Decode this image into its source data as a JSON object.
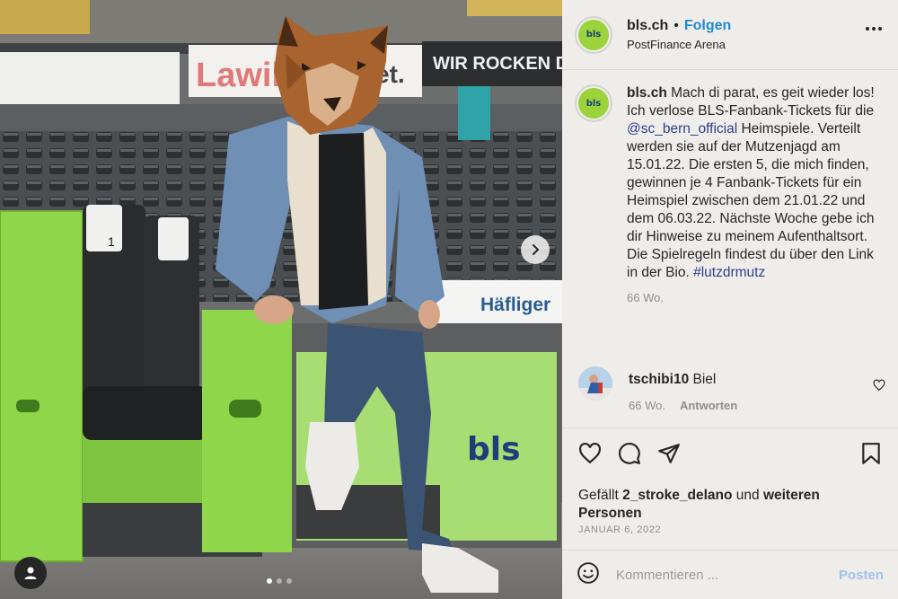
{
  "post": {
    "username": "bls.ch",
    "separator": "•",
    "follow_label": "Folgen",
    "location": "PostFinance Arena",
    "brand_logo_text": "bls"
  },
  "photo": {
    "stadium_banner_left": "Lawil",
    "stadium_banner_mid": "et.",
    "stadium_banner_right": "WIR ROCKEN D",
    "sponsor_board": "Häfliger",
    "bench_logo": "bls",
    "seat_number": "1",
    "carousel_total": 3,
    "carousel_current": 1
  },
  "caption": {
    "username": "bls.ch",
    "part1": " Mach di parat, es geit wieder los! Ich verlose BLS-Fanbank-Tickets für die ",
    "mention": "@sc_bern_official",
    "part2": " Heimspiele. Verteilt werden sie auf der Mutzenjagd am 15.01.22. Die ersten 5, die mich finden, gewinnen je 4 Fanbank-Tickets für ein Heimspiel zwischen dem 21.01.22 und dem 06.03.22. Nächste Woche gebe ich dir Hinweise zu meinem Aufenthaltsort. Die Spielregeln findest du über den Link in der Bio. ",
    "hashtag": "#lutzdrmutz",
    "age": "66 Wo."
  },
  "comment": {
    "username": "tschibi10",
    "text": " Biel",
    "age": "66 Wo.",
    "reply_label": "Antworten"
  },
  "likes": {
    "prefix": "Gefällt ",
    "user": "2_stroke_delano",
    "middle": " und ",
    "rest": "weiteren Personen"
  },
  "date": "JANUAR 6, 2022",
  "add_comment": {
    "placeholder": "Kommentieren ...",
    "post_label": "Posten"
  },
  "colors": {
    "brand_green": "#9ad43a",
    "link_blue": "#1e88d6",
    "mention_color": "#2c3f8c"
  },
  "icons": {
    "header_more": "more-horizontal-icon",
    "carousel_next": "chevron-right-icon",
    "tag": "user-tag-icon",
    "like": "heart-icon",
    "comment": "comment-bubble-icon",
    "share": "paper-plane-icon",
    "save": "bookmark-icon",
    "emoji": "smiley-icon"
  }
}
